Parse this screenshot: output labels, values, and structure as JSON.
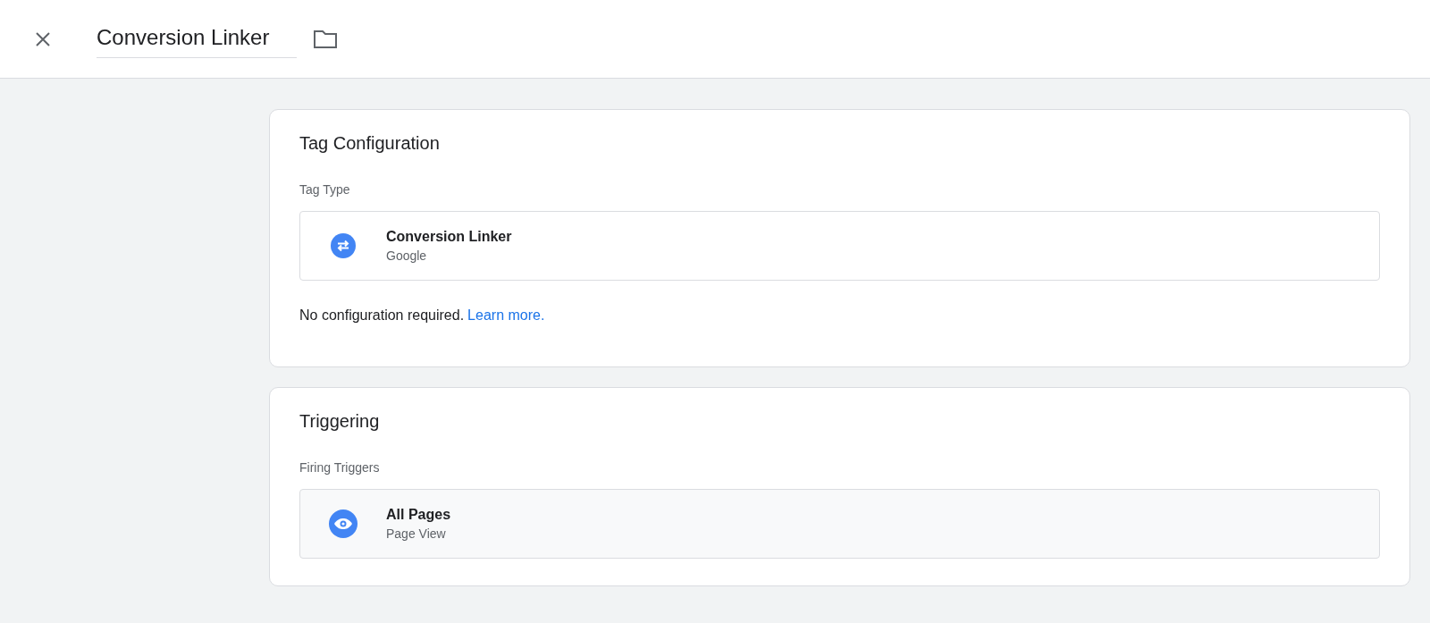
{
  "header": {
    "title": "Conversion Linker"
  },
  "sections": [
    {
      "title": "Tag Configuration",
      "label": "Tag Type",
      "item": {
        "kind": "tag",
        "name": "Conversion Linker",
        "subtitle": "Google"
      },
      "note": {
        "text": "No configuration required.",
        "link": "Learn more."
      }
    },
    {
      "title": "Triggering",
      "label": "Firing Triggers",
      "item": {
        "kind": "trigger",
        "name": "All Pages",
        "subtitle": "Page View"
      }
    }
  ]
}
